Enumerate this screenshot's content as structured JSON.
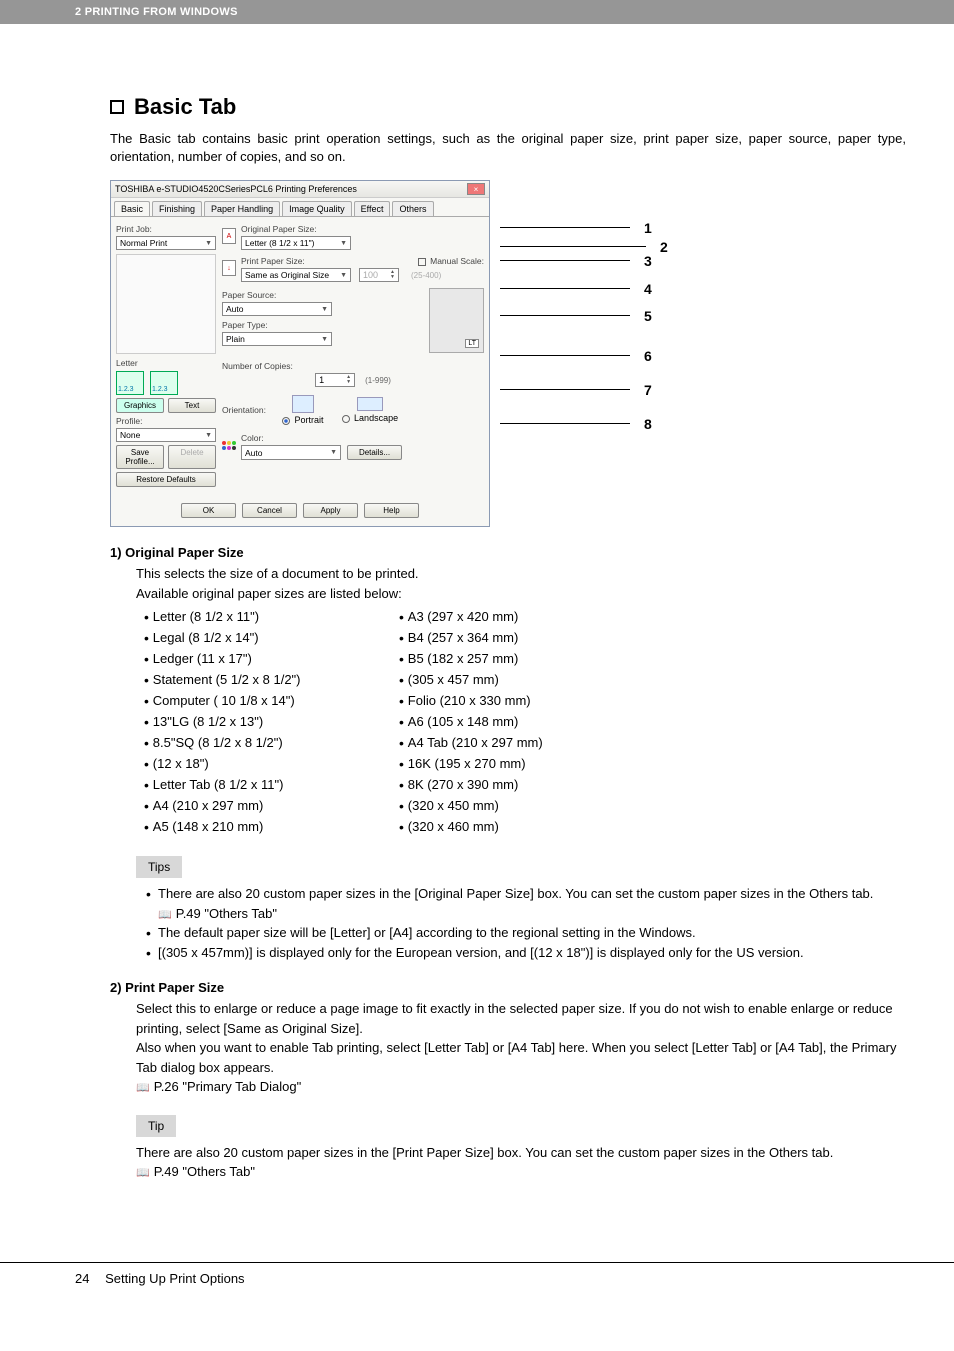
{
  "header": {
    "text": "2 PRINTING FROM WINDOWS"
  },
  "title": {
    "text": "Basic Tab"
  },
  "intro": "The Basic tab contains basic print operation settings, such as the original paper size, print paper size, paper source, paper type, orientation, number of copies, and so on.",
  "dialog": {
    "titlebar": "TOSHIBA e-STUDIO4520CSeriesPCL6 Printing Preferences",
    "tabs": [
      "Basic",
      "Finishing",
      "Paper Handling",
      "Image Quality",
      "Effect",
      "Others"
    ],
    "left": {
      "print_job_label": "Print Job:",
      "print_job_value": "Normal Print",
      "thumb_letter": "Letter",
      "thumb_num": "1.2.3",
      "btn_graphics": "Graphics",
      "btn_text": "Text",
      "profile_label": "Profile:",
      "profile_value": "None",
      "btn_save": "Save Profile...",
      "btn_delete": "Delete",
      "btn_restore": "Restore Defaults"
    },
    "right": {
      "orig_size_label": "Original Paper Size:",
      "orig_size_value": "Letter (8 1/2 x 11\")",
      "print_size_label": "Print Paper Size:",
      "print_size_value": "Same as Original Size",
      "manual_scale_label": "Manual Scale:",
      "manual_scale_value": "100",
      "manual_scale_range": "(25-400)",
      "paper_source_label": "Paper Source:",
      "paper_source_value": "Auto",
      "paper_type_label": "Paper Type:",
      "paper_type_value": "Plain",
      "tray_label": "LT",
      "copies_label": "Number of Copies:",
      "copies_value": "1",
      "copies_range": "(1-999)",
      "orientation_label": "Orientation:",
      "orient_portrait": "Portrait",
      "orient_landscape": "Landscape",
      "color_label": "Color:",
      "color_value": "Auto",
      "btn_details": "Details..."
    },
    "footer": {
      "ok": "OK",
      "cancel": "Cancel",
      "apply": "Apply",
      "help": "Help"
    }
  },
  "annotations": [
    "1",
    "2",
    "3",
    "4",
    "5",
    "6",
    "7",
    "8"
  ],
  "section1": {
    "head": "1)  Original Paper Size",
    "body": [
      "This selects the size of a document to be printed.",
      "Available original paper sizes are listed below:"
    ],
    "col1": [
      "Letter  (8 1/2 x 11\")",
      "Legal  (8 1/2 x 14\")",
      "Ledger  (11 x 17\")",
      "Statement  (5 1/2 x 8 1/2\")",
      "Computer ( 10 1/8 x 14\")",
      "13\"LG  (8 1/2 x 13\")",
      "8.5\"SQ  (8 1/2 x 8 1/2\")",
      "(12 x 18\")",
      "Letter Tab (8 1/2 x 11\")",
      "A4 (210 x 297 mm)",
      "A5 (148 x 210 mm)"
    ],
    "col2": [
      "A3 (297 x 420 mm)",
      "B4 (257 x 364 mm)",
      "B5 (182 x 257 mm)",
      "(305 x 457 mm)",
      "Folio (210 x 330 mm)",
      "A6 (105 x 148 mm)",
      "A4 Tab (210 x 297 mm)",
      "16K (195 x 270 mm)",
      "8K (270 x 390 mm)",
      "(320 x 450 mm)",
      "(320 x 460 mm)"
    ]
  },
  "tips1": {
    "label": "Tips",
    "items": [
      "There are also 20 custom paper sizes in the [Original Paper Size] box.  You can set the custom paper sizes in the Others tab.",
      "The default paper size will be [Letter] or [A4] according to the regional setting in the Windows.",
      "[(305 x 457mm)] is displayed only for the European version, and [(12 x 18\")] is displayed only for the US version."
    ],
    "ref": "P.49 \"Others Tab\""
  },
  "section2": {
    "head": "2)  Print Paper Size",
    "body": [
      "Select this to enlarge or reduce a page image to fit exactly in the selected paper size.  If you do not wish to enable enlarge or reduce printing, select [Same as Original Size].",
      "Also when you want to enable Tab printing, select [Letter Tab] or [A4 Tab] here.  When you select [Letter Tab] or [A4 Tab], the Primary Tab dialog box appears."
    ],
    "ref": "P.26 \"Primary Tab Dialog\""
  },
  "tip2": {
    "label": "Tip",
    "text": "There are also 20 custom paper sizes in the [Print Paper Size] box.  You can set the custom paper sizes in the Others tab.",
    "ref": "P.49 \"Others Tab\""
  },
  "footer": {
    "page": "24",
    "section": "Setting Up Print Options"
  }
}
